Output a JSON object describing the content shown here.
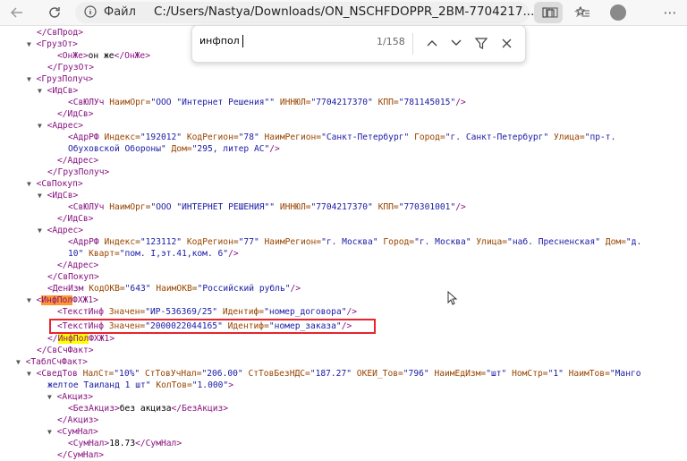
{
  "browser": {
    "addr_label": "Файл",
    "url": "C:/Users/Nastya/Downloads/ON_NSCHFDOPPR_2BM-7704217..."
  },
  "find": {
    "query": "инфпол",
    "count": "1/158"
  },
  "icons": {
    "back": "arrow-left-icon",
    "refresh": "refresh-icon",
    "info": "info-icon",
    "reader": "reader-icon",
    "favorite": "star-icon",
    "split": "split-screen-icon",
    "favorites_list": "favorites-icon",
    "profile": "profile-icon",
    "more": "more-icon",
    "prev": "chevron-up-icon",
    "next": "chevron-down-icon",
    "filter": "filter-icon",
    "close": "close-icon",
    "collapse": "triangle-down-icon",
    "cursor": "mouse-cursor-icon"
  },
  "colors": {
    "tag": "#881280",
    "attr_name": "#994500",
    "attr_value": "#1a1aa6",
    "current_match": "#ff9632",
    "match": "#ffff00",
    "outline": "#e8242e"
  },
  "xml": {
    "l0": {
      "close": "</СвПрод>"
    },
    "l1": {
      "open": "<ГрузОт>"
    },
    "l2": {
      "open": "<ОнЖе>",
      "text": "он же",
      "close": "</ОнЖе>"
    },
    "l3": {
      "close": "</ГрузОт>"
    },
    "l4": {
      "open": "<ГрузПолуч>"
    },
    "l5": {
      "open": "<ИдСв>"
    },
    "l6": {
      "tag": "<СвЮЛУч",
      "a1n": "НаимОрг=",
      "a1v": "\"ООО \"Интернет Решения\"\"",
      "a2n": "ИННЮЛ=",
      "a2v": "\"7704217370\"",
      "a3n": "КПП=",
      "a3v": "\"781145015\"",
      "end": "/>"
    },
    "l7": {
      "close": "</ИдСв>"
    },
    "l8": {
      "open": "<Адрес>"
    },
    "l9": {
      "tag": "<АдрРФ",
      "a1n": "Индекс=",
      "a1v": "\"192012\"",
      "a2n": "КодРегион=",
      "a2v": "\"78\"",
      "a3n": "НаимРегион=",
      "a3v": "\"Санкт-Петербург\"",
      "a4n": "Город=",
      "a4v": "\"г. Санкт-Петербург\"",
      "a5n": "Улица=",
      "a5v": "\"пр-т."
    },
    "l10": {
      "v": "Обуховской Обороны\"",
      "an": "Дом=",
      "av": "\"295, литер АС\"",
      "end": "/>"
    },
    "l11": {
      "close": "</Адрес>"
    },
    "l12": {
      "close": "</ГрузПолуч>"
    },
    "l13": {
      "open": "<СвПокуп>"
    },
    "l14": {
      "open": "<ИдСв>"
    },
    "l15": {
      "tag": "<СвЮЛУч",
      "a1n": "НаимОрг=",
      "a1v": "\"ООО \"ИНТЕРНЕТ РЕШЕНИЯ\"\"",
      "a2n": "ИННЮЛ=",
      "a2v": "\"7704217370\"",
      "a3n": "КПП=",
      "a3v": "\"770301001\"",
      "end": "/>"
    },
    "l16": {
      "close": "</ИдСв>"
    },
    "l17": {
      "open": "<Адрес>"
    },
    "l18": {
      "tag": "<АдрРФ",
      "a1n": "Индекс=",
      "a1v": "\"123112\"",
      "a2n": "КодРегион=",
      "a2v": "\"77\"",
      "a3n": "НаимРегион=",
      "a3v": "\"г. Москва\"",
      "a4n": "Город=",
      "a4v": "\"г. Москва\"",
      "a5n": "Улица=",
      "a5v": "\"наб. Пресненская\"",
      "a6n": "Дом=",
      "a6v": "\"д."
    },
    "l19": {
      "v": "10\"",
      "an": "Кварт=",
      "av": "\"пом. I,эт.41,ком. 6\"",
      "end": "/>"
    },
    "l20": {
      "close": "</Адрес>"
    },
    "l21": {
      "close": "</СвПокуп>"
    },
    "l22": {
      "tag": "<ДенИзм",
      "a1n": "КодОКВ=",
      "a1v": "\"643\"",
      "a2n": "НаимОКВ=",
      "a2v": "\"Российский рубль\"",
      "end": "/>"
    },
    "l23": {
      "pre": "<",
      "hl": "ИнфПол",
      "post": "ФХЖ1>"
    },
    "l24": {
      "tag": "<ТекстИнф",
      "a1n": "Значен=",
      "a1v": "\"ИР-536369/25\"",
      "a2n": "Идентиф=",
      "a2v": "\"номер_договора\"",
      "end": "/>"
    },
    "l25": {
      "tag": "<ТекстИнф",
      "a1n": "Значен=",
      "a1v": "\"2000022044165\"",
      "a2n": "Идентиф=",
      "a2v": "\"номер_заказа\"",
      "end": "/>"
    },
    "l26": {
      "pre": "</",
      "hl": "ИнфПол",
      "post": "ФХЖ1>"
    },
    "l27": {
      "close": "</СвСчФакт>"
    },
    "l28": {
      "open": "<ТаблСчФакт>"
    },
    "l29": {
      "tag": "<СведТов",
      "a1n": "НалСт=",
      "a1v": "\"10%\"",
      "a2n": "СтТовУчНал=",
      "a2v": "\"206.00\"",
      "a3n": "СтТовБезНДС=",
      "a3v": "\"187.27\"",
      "a4n": "ОКЕИ_Тов=",
      "a4v": "\"796\"",
      "a5n": "НаимЕдИзм=",
      "a5v": "\"шт\"",
      "a6n": "НомСтр=",
      "a6v": "\"1\"",
      "a7n": "НаимТов=",
      "a7v": "\"Манго"
    },
    "l30": {
      "v": "желтое Таиланд 1 шт\"",
      "an": "КолТов=",
      "av": "\"1.000\"",
      "end": ">"
    },
    "l31": {
      "open": "<Акциз>"
    },
    "l32": {
      "open": "<БезАкциз>",
      "text": "без акциза",
      "close": "</БезАкциз>"
    },
    "l33": {
      "close": "</Акциз>"
    },
    "l34": {
      "open": "<СумНал>"
    },
    "l35": {
      "open": "<СумНал>",
      "text": "18.73",
      "close": "</СумНал>"
    },
    "l36": {
      "close": "</СумНал>"
    }
  }
}
